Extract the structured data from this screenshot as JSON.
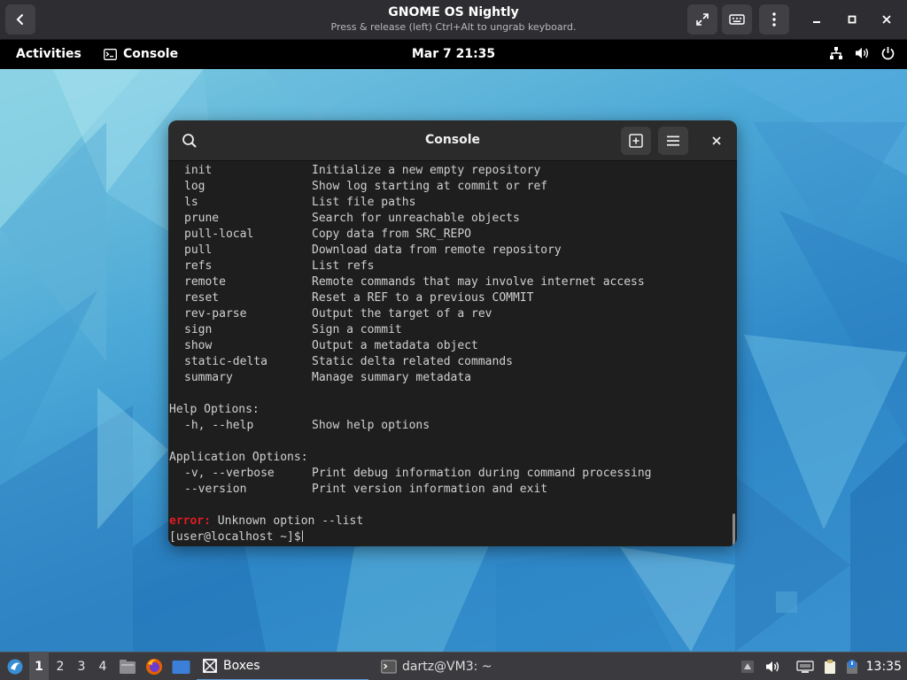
{
  "vm": {
    "title": "GNOME OS Nightly",
    "subtitle": "Press & release (left) Ctrl+Alt to ungrab keyboard."
  },
  "gnome_topbar": {
    "activities": "Activities",
    "app_name": "Console",
    "clock": "Mar 7  21:35"
  },
  "console": {
    "title": "Console",
    "commands": [
      {
        "cmd": "init",
        "desc": "Initialize a new empty repository"
      },
      {
        "cmd": "log",
        "desc": "Show log starting at commit or ref"
      },
      {
        "cmd": "ls",
        "desc": "List file paths"
      },
      {
        "cmd": "prune",
        "desc": "Search for unreachable objects"
      },
      {
        "cmd": "pull-local",
        "desc": "Copy data from SRC_REPO"
      },
      {
        "cmd": "pull",
        "desc": "Download data from remote repository"
      },
      {
        "cmd": "refs",
        "desc": "List refs"
      },
      {
        "cmd": "remote",
        "desc": "Remote commands that may involve internet access"
      },
      {
        "cmd": "reset",
        "desc": "Reset a REF to a previous COMMIT"
      },
      {
        "cmd": "rev-parse",
        "desc": "Output the target of a rev"
      },
      {
        "cmd": "sign",
        "desc": "Sign a commit"
      },
      {
        "cmd": "show",
        "desc": "Output a metadata object"
      },
      {
        "cmd": "static-delta",
        "desc": "Static delta related commands"
      },
      {
        "cmd": "summary",
        "desc": "Manage summary metadata"
      }
    ],
    "help_heading": "Help Options:",
    "help_options": [
      {
        "cmd": "-h, --help",
        "desc": "Show help options"
      }
    ],
    "app_heading": "Application Options:",
    "app_options": [
      {
        "cmd": "-v, --verbose",
        "desc": "Print debug information during command processing"
      },
      {
        "cmd": "--version",
        "desc": "Print version information and exit"
      }
    ],
    "error_label": "error:",
    "error_text": " Unknown option --list",
    "prompt": "[user@localhost ~]$"
  },
  "taskbar": {
    "workspaces": [
      "1",
      "2",
      "3",
      "4"
    ],
    "active_workspace": "1",
    "task_boxes": "Boxes",
    "task_terminal": "dartz@VM3: ~",
    "clock": "13:35"
  },
  "colors": {
    "error": "#e01b24",
    "accent": "#5b9bd5",
    "terminal_bg": "#1e1e1e"
  }
}
